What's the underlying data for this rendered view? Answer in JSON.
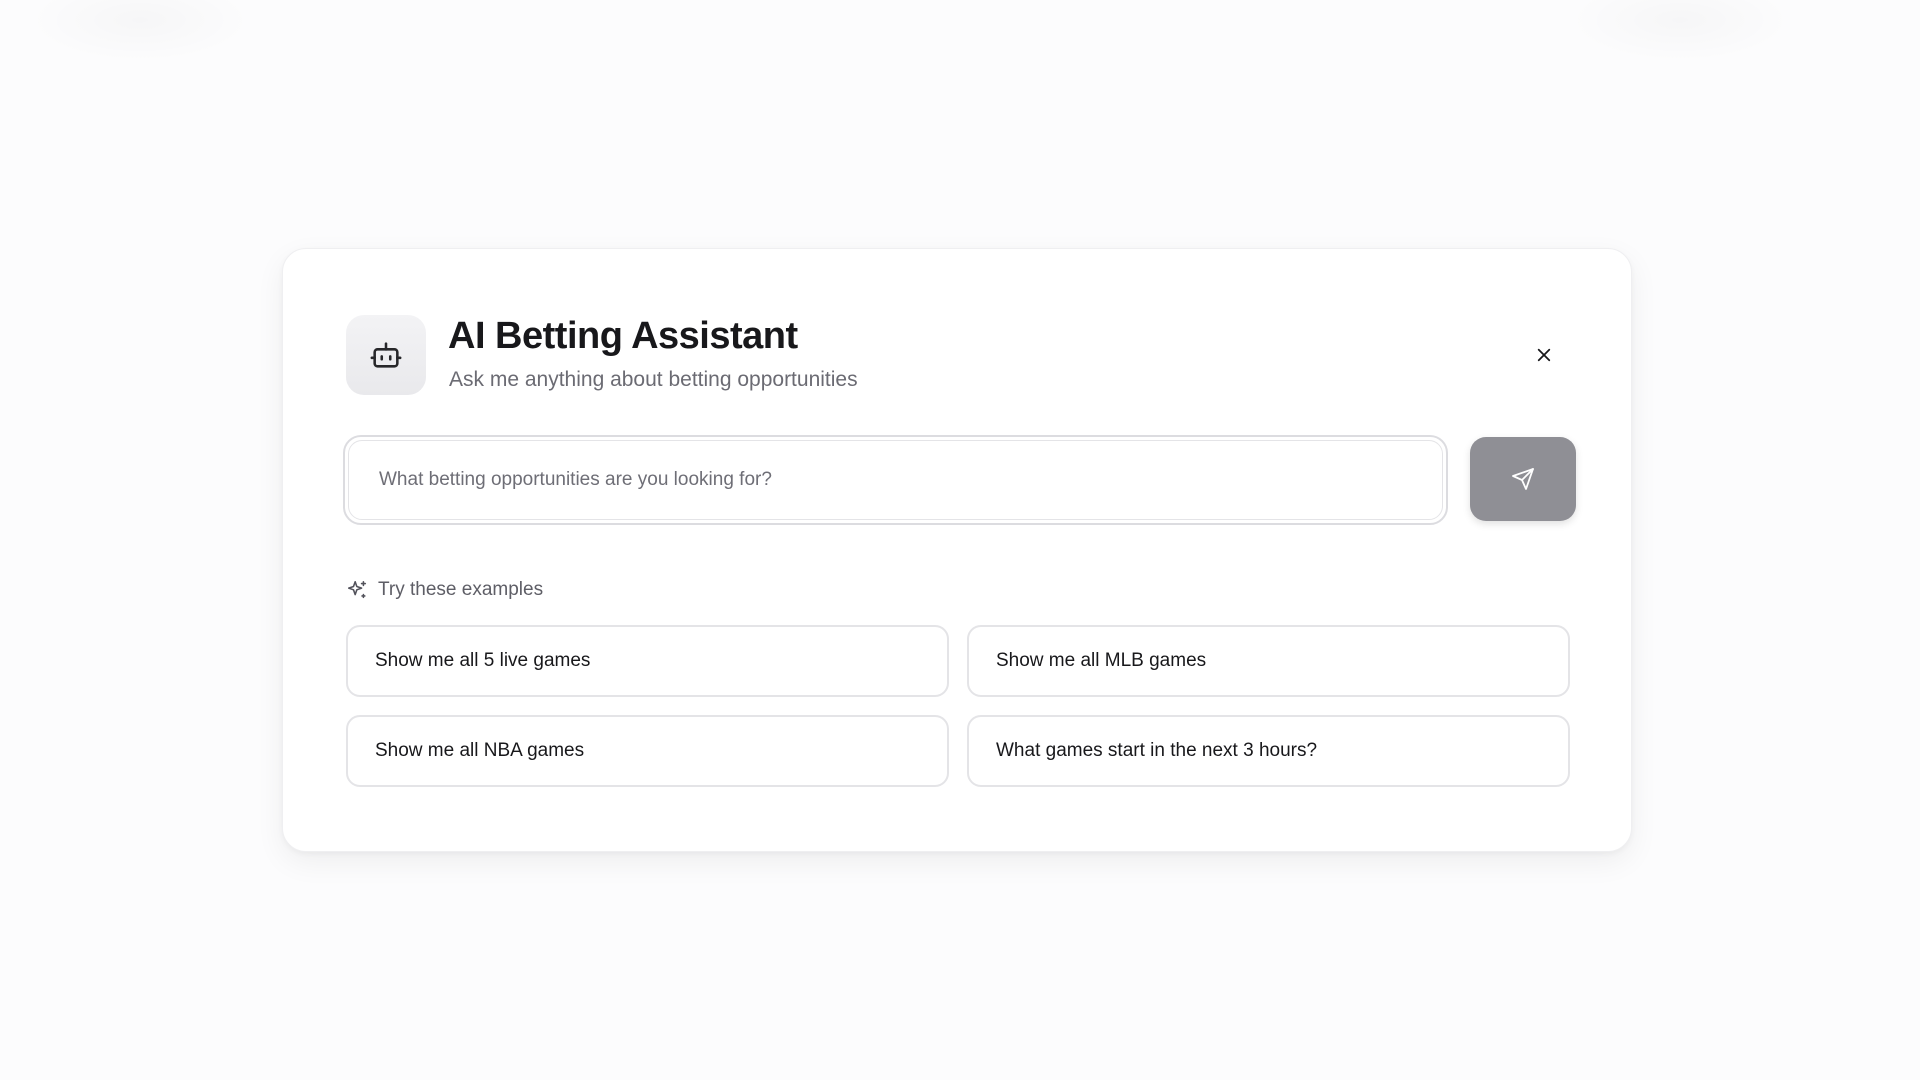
{
  "header": {
    "title": "AI Betting Assistant",
    "subtitle": "Ask me anything about betting opportunities"
  },
  "search": {
    "placeholder": "What betting opportunities are you looking for?",
    "value": ""
  },
  "examples": {
    "label": "Try these examples",
    "items": [
      "Show me all 5 live games",
      "Show me all MLB games",
      "Show me all NBA games",
      "What games start in the next 3 hours?"
    ]
  },
  "icons": {
    "assistant": "bot-icon",
    "close": "close-icon",
    "send": "send-icon",
    "examples": "sparkles-icon"
  },
  "colors": {
    "send_button": "#8f8f95",
    "title": "#18181b",
    "subtitle": "#6b6b73"
  }
}
